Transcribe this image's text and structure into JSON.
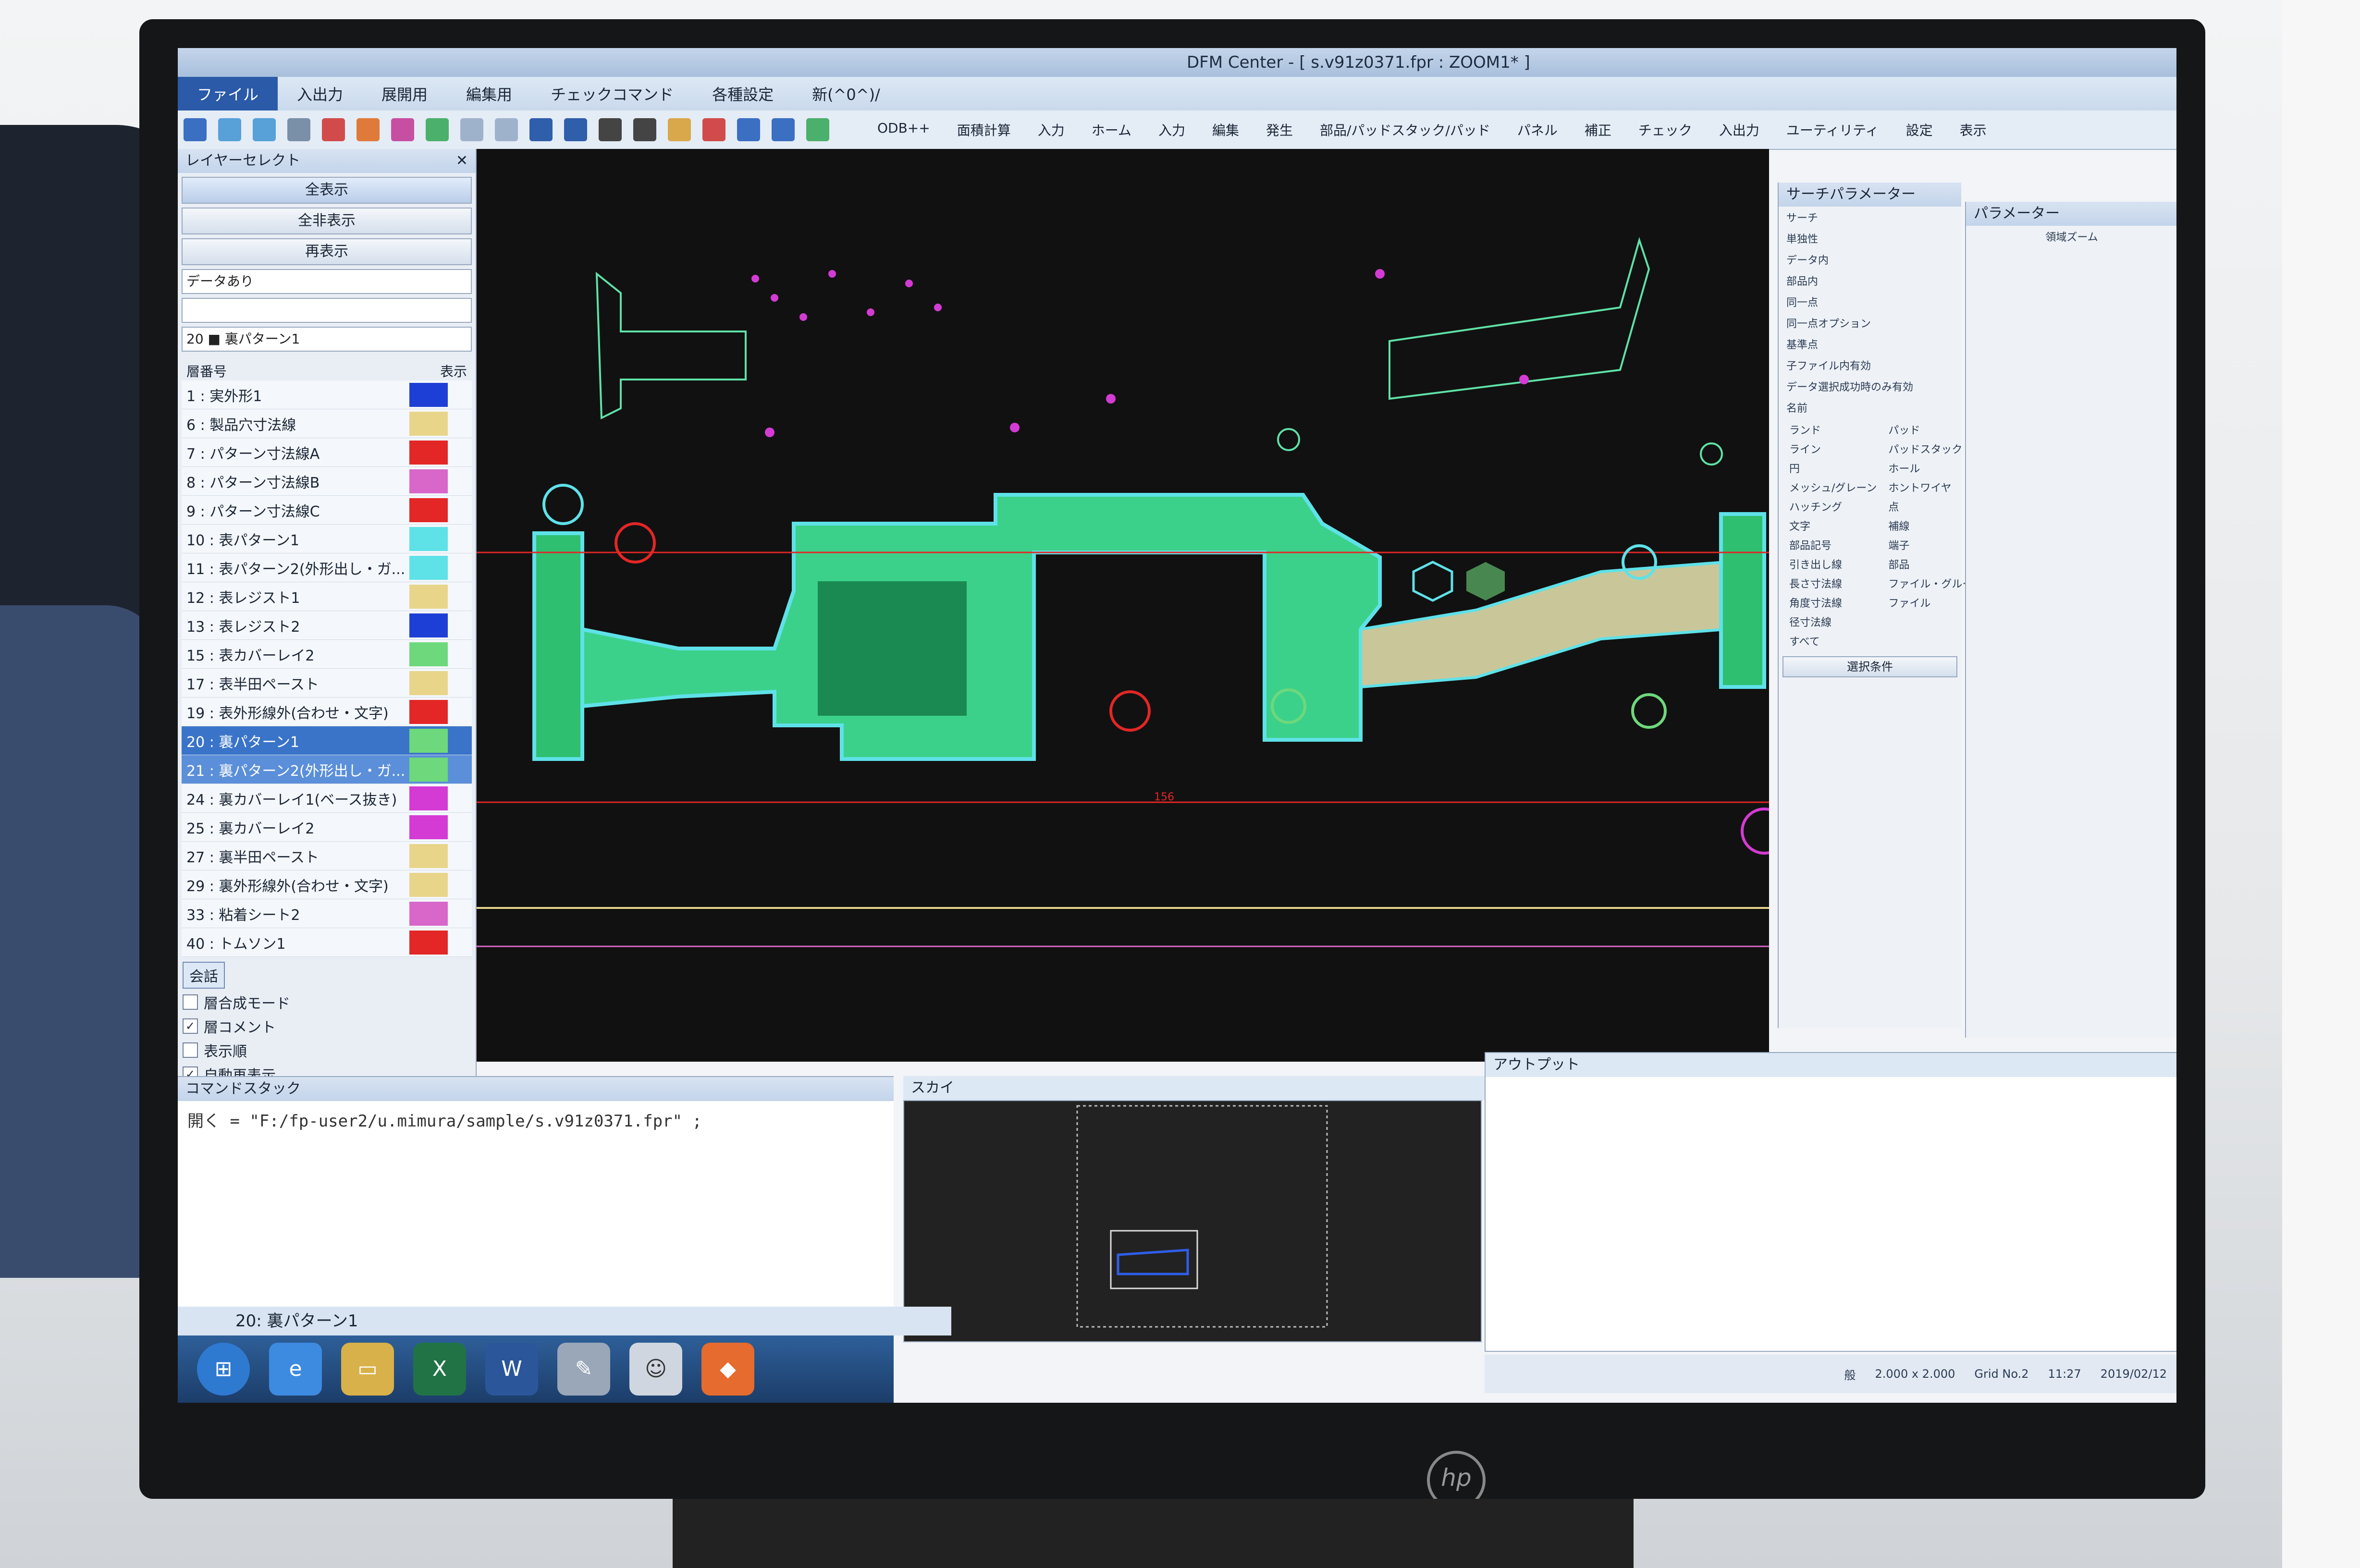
{
  "app": {
    "title": "DFM Center - [ s.v91z0371.fpr : ZOOM1* ]"
  },
  "menus": [
    "ファイル",
    "入出力",
    "展開用",
    "編集用",
    "チェックコマンド",
    "各種設定",
    "新(^0^)/",
    "ODB++",
    "面積計算",
    "入力",
    "ホーム",
    "入力",
    "編集",
    "発生",
    "部品/パッドスタック/パッド",
    "パネル",
    "補正",
    "チェック",
    "入出力",
    "ユーティリティ",
    "設定",
    "表示"
  ],
  "layer_panel": {
    "title": "レイヤーセレクト",
    "buttons": [
      "全表示",
      "全非表示",
      "再表示"
    ],
    "filter": "データあり",
    "current_layer": "20 ■ 裏パターン1",
    "col_num": "層番号",
    "col_show": "表示",
    "layers": [
      {
        "label": "1 : 実外形1",
        "color": "#1e3fd6"
      },
      {
        "label": "6 : 製品穴寸法線",
        "color": "#e8d58a"
      },
      {
        "label": "7 : パターン寸法線A",
        "color": "#e32626"
      },
      {
        "label": "8 : パターン寸法線B",
        "color": "#d867c9"
      },
      {
        "label": "9 : パターン寸法線C",
        "color": "#e32626"
      },
      {
        "label": "10 : 表パターン1",
        "color": "#5fe1e8"
      },
      {
        "label": "11 : 表パターン2(外形出し・ガ...",
        "color": "#5fe1e8"
      },
      {
        "label": "12 : 表レジスト1",
        "color": "#e8d58a"
      },
      {
        "label": "13 : 表レジスト2",
        "color": "#1e3fd6"
      },
      {
        "label": "15 : 表カバーレイ2",
        "color": "#6ed87c"
      },
      {
        "label": "17 : 表半田ペースト",
        "color": "#e8d58a"
      },
      {
        "label": "19 : 表外形線外(合わせ・文字)",
        "color": "#e32626"
      },
      {
        "label": "20 : 裏パターン1",
        "color": "#6ed87c"
      },
      {
        "label": "21 : 裏パターン2(外形出し・ガ...",
        "color": "#6ed87c"
      },
      {
        "label": "24 : 裏カバーレイ1(ベース抜き)",
        "color": "#d43bd4"
      },
      {
        "label": "25 : 裏カバーレイ2",
        "color": "#d43bd4"
      },
      {
        "label": "27 : 裏半田ペースト",
        "color": "#e8d58a"
      },
      {
        "label": "29 : 裏外形線外(合わせ・文字)",
        "color": "#e8d58a"
      },
      {
        "label": "33 : 粘着シート2",
        "color": "#d867c9"
      },
      {
        "label": "40 : トムソン1",
        "color": "#e32626"
      }
    ],
    "tab": "会話",
    "options": [
      {
        "label": "層合成モード",
        "checked": false
      },
      {
        "label": "層コメント",
        "checked": true
      },
      {
        "label": "表示順",
        "checked": false
      },
      {
        "label": "自動再表示",
        "checked": true
      }
    ]
  },
  "search_panel": {
    "title": "サーチパラメーター",
    "group": "サーチ",
    "rows": [
      "単独性",
      "データ内",
      "部品内",
      "同一点",
      "同一点オプション",
      "基準点",
      "子ファイル内有効",
      "データ選択成功時のみ有効"
    ],
    "name_title": "名前",
    "names_left": [
      "ランド",
      "ライン",
      "円",
      "メッシュ/グレーン",
      "ハッチング",
      "文字",
      "部品記号",
      "引き出し線",
      "長さ寸法線",
      "角度寸法線",
      "径寸法線",
      "すべて"
    ],
    "names_right": [
      "パッド",
      "パッドスタック",
      "ホール",
      "ホントワイヤ",
      "点",
      "補線",
      "端子",
      "部品",
      "ファイル・グループ",
      "ファイル"
    ],
    "select_btn": "選択条件"
  },
  "param_panel": {
    "title": "パラメーター",
    "sub": "領域ズーム"
  },
  "command_stack": {
    "title": "コマンドスタック",
    "line": "開く = \"F:/fp-user2/u.mimura/sample/s.v91z0371.fpr\" ;"
  },
  "sky_panel": {
    "title": "スカイ"
  },
  "output_panel": {
    "title": "アウトプット"
  },
  "status": {
    "grid": "2.000 x 2.000",
    "grid_name": "Grid No.2",
    "time": "11:27",
    "date": "2019/02/12",
    "ime": "般"
  },
  "taskbar": {
    "active_layer": "20: 裏パターン1"
  },
  "canvas": {
    "dimension_label": "156"
  }
}
